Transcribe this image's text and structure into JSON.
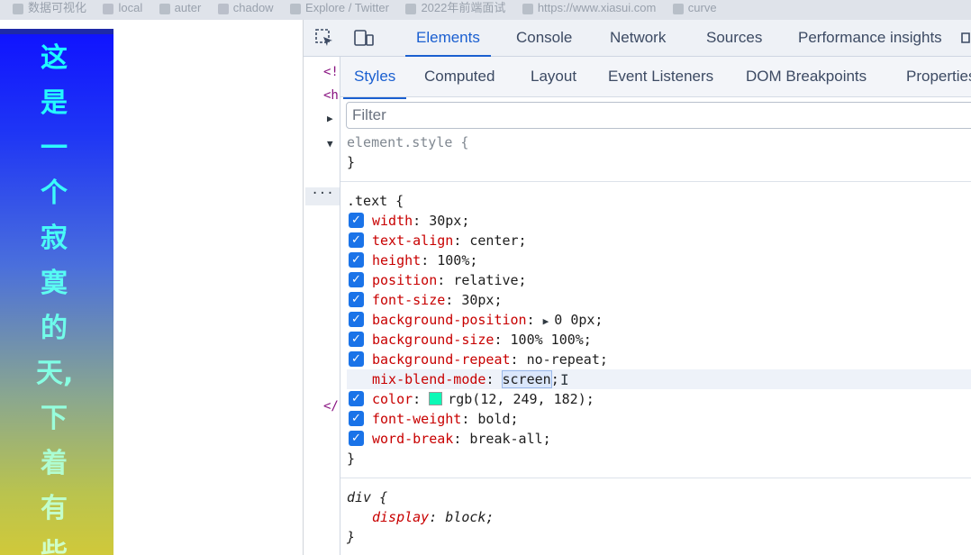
{
  "bookmarks": [
    "数据可视化",
    "local",
    "auter",
    "chadow",
    "Explore / Twitter",
    "2022年前端面试",
    "https://www.xiasui.com",
    "curve"
  ],
  "page": {
    "vertical_text": "这是一个寂寞的天,下着有些",
    "text_color": "#0cf9b6"
  },
  "devtools": {
    "main_tabs": [
      {
        "label": "Elements",
        "active": true
      },
      {
        "label": "Console"
      },
      {
        "label": "Network"
      },
      {
        "label": "Sources"
      },
      {
        "label": "Performance insights"
      }
    ],
    "tree_fragments": [
      "<!",
      "<h",
      "</"
    ],
    "more_dots": "···",
    "sub_tabs": [
      {
        "label": "Styles",
        "active": true
      },
      {
        "label": "Computed"
      },
      {
        "label": "Layout"
      },
      {
        "label": "Event Listeners"
      },
      {
        "label": "DOM Breakpoints"
      },
      {
        "label": "Properties"
      }
    ],
    "filter_placeholder": "Filter",
    "element_style": {
      "selector": "element.style {",
      "close": "}"
    },
    "text_rule": {
      "selector": ".text {",
      "close": "}",
      "declarations": [
        {
          "name": "width",
          "value": "30px;",
          "checked": true
        },
        {
          "name": "text-align",
          "value": "center;",
          "checked": true
        },
        {
          "name": "height",
          "value": "100%;",
          "checked": true
        },
        {
          "name": "position",
          "value": "relative;",
          "checked": true
        },
        {
          "name": "font-size",
          "value": "30px;",
          "checked": true
        },
        {
          "name": "background-position",
          "value": "0 0px;",
          "checked": true
        },
        {
          "name": "background-size",
          "value": "100% 100%;",
          "checked": true
        },
        {
          "name": "background-repeat",
          "value": "no-repeat;",
          "checked": true
        },
        {
          "name": "mix-blend-mode",
          "value": "screen",
          "checked": false
        },
        {
          "name": "color",
          "value": "rgb(12, 249, 182);",
          "checked": true,
          "swatch": "#0cf9b6"
        },
        {
          "name": "font-weight",
          "value": "bold;",
          "checked": true
        },
        {
          "name": "word-break",
          "value": "break-all;",
          "checked": true
        }
      ]
    },
    "div_rule": {
      "selector": "div {",
      "close": "}",
      "declarations": [
        {
          "name": "display",
          "value": "block;"
        }
      ]
    }
  }
}
